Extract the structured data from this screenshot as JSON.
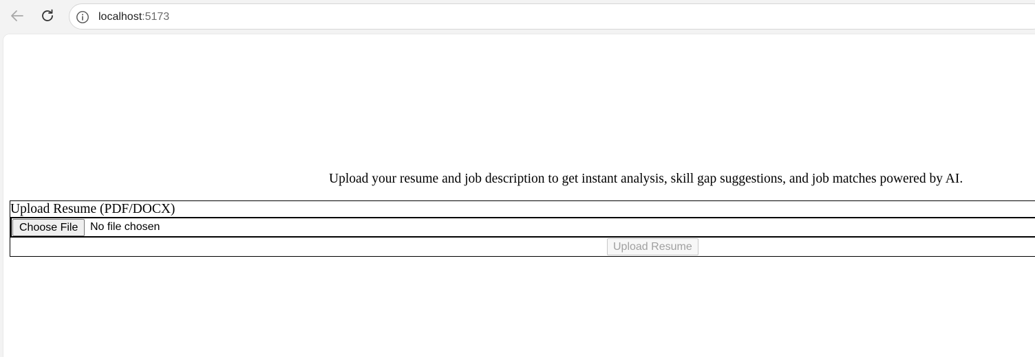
{
  "browser": {
    "url_host": "localhost",
    "url_port": ":5173",
    "icons": {
      "back": "arrow-left-icon",
      "reload": "reload-icon",
      "site_info": "info-icon"
    }
  },
  "page": {
    "tagline": "Upload your resume and job description to get instant analysis, skill gap suggestions, and job matches powered by AI.",
    "upload_form": {
      "label": "Upload Resume (PDF/DOCX)",
      "choose_file_label": "Choose File",
      "file_status": "No file chosen",
      "upload_button_label": "Upload Resume",
      "upload_button_disabled": true
    }
  },
  "colors": {
    "toolbar_bg": "#f3f3f3",
    "page_bg": "#ffffff",
    "disabled_text": "#a0a0a0"
  }
}
